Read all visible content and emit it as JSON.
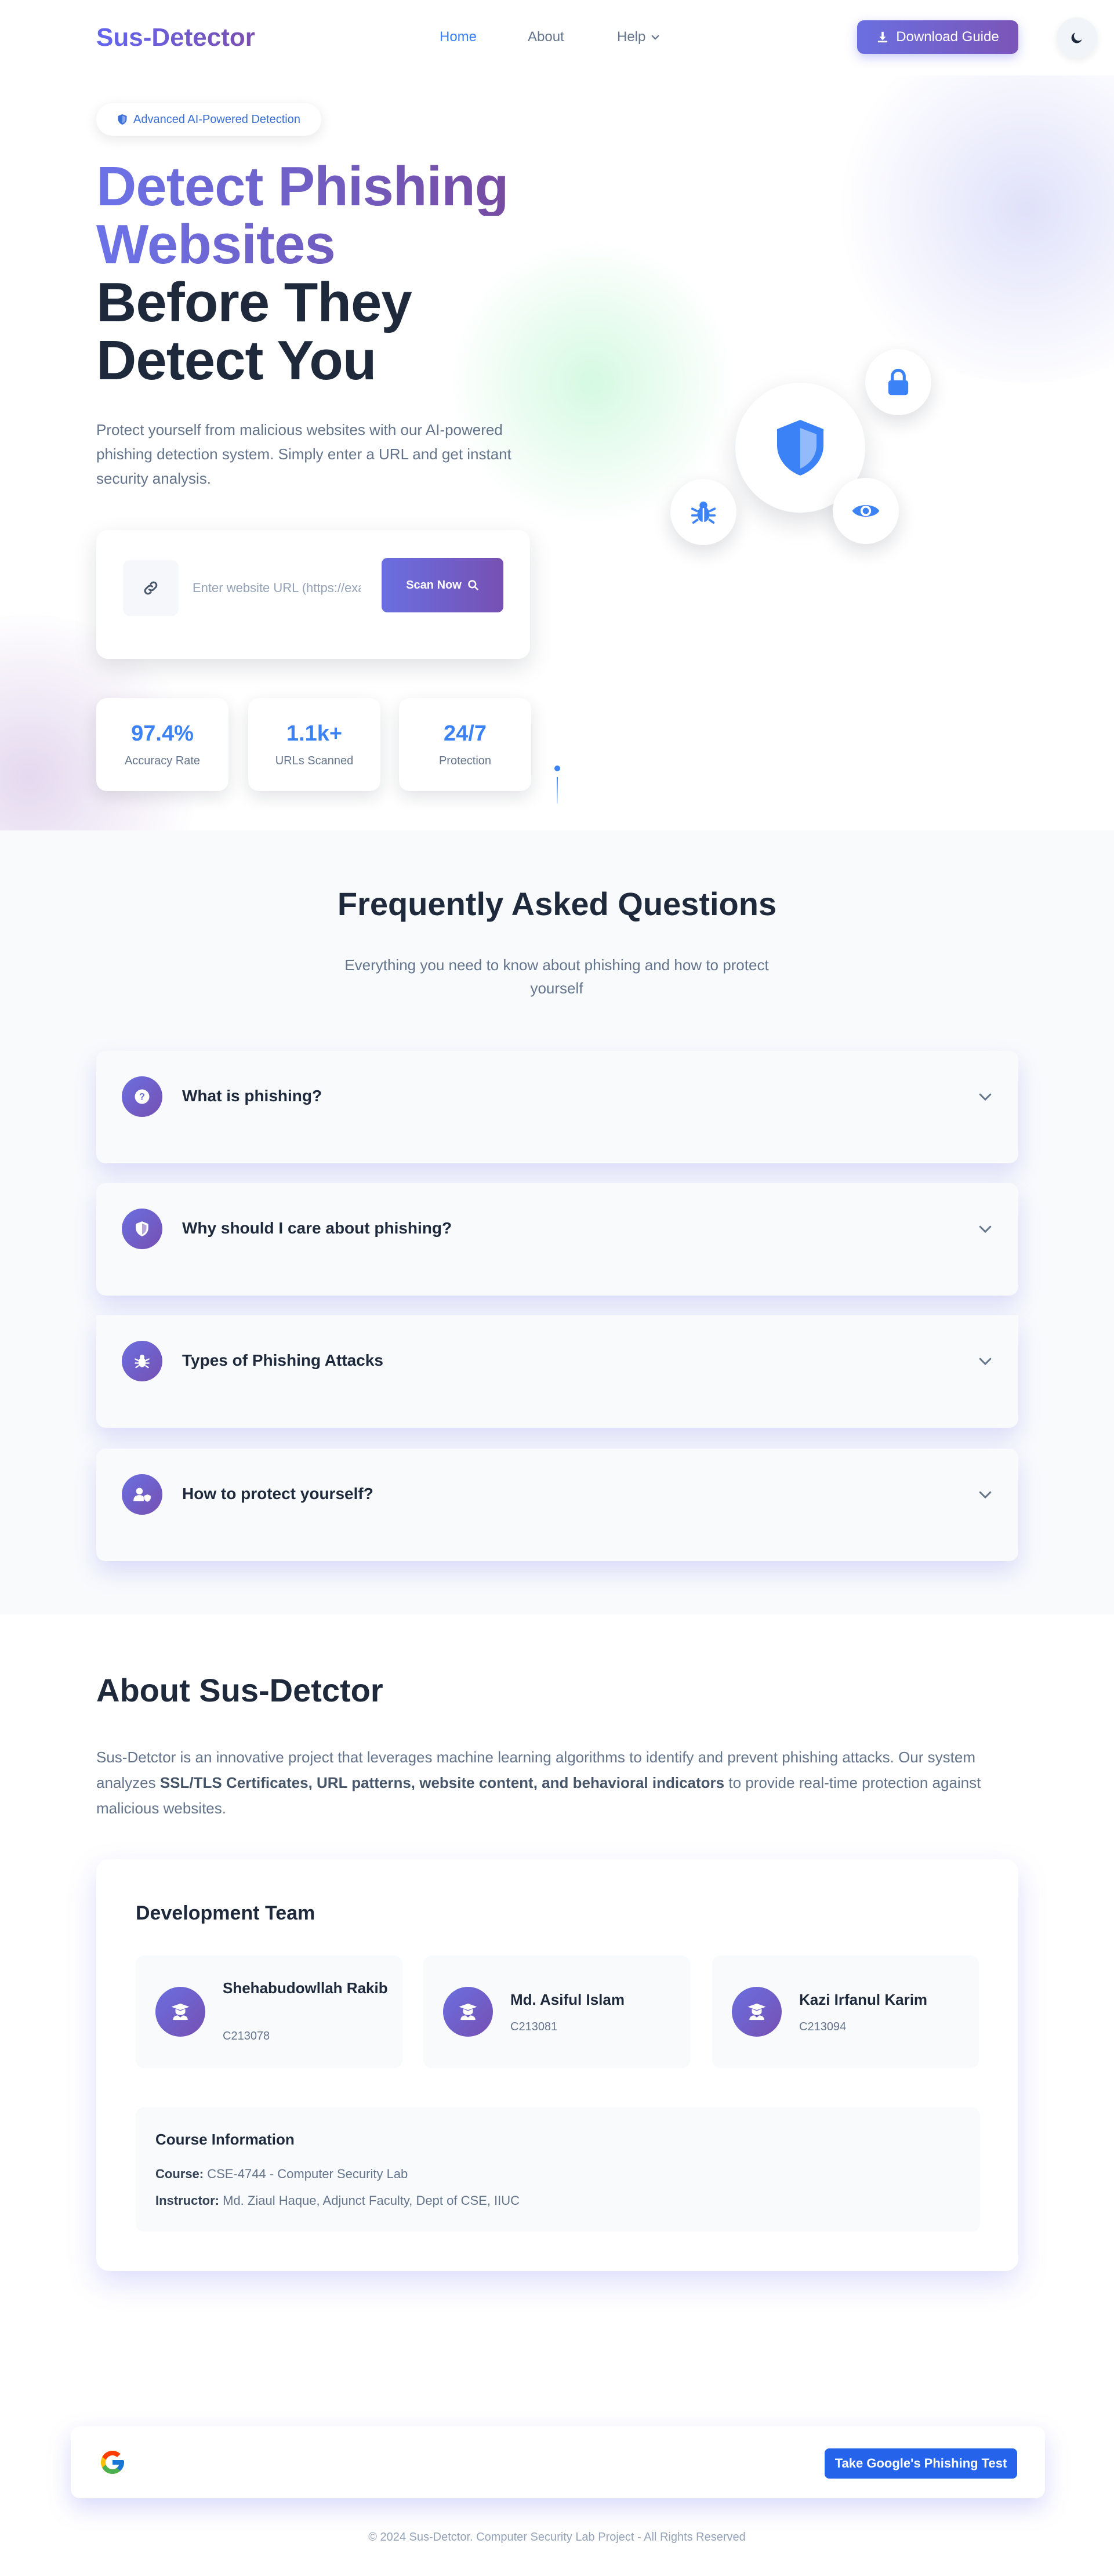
{
  "nav": {
    "logo": "Sus-Detector",
    "links": [
      "Home",
      "About",
      "Help"
    ],
    "download_label": "Download Guide"
  },
  "hero": {
    "badge": "Advanced AI-Powered Detection",
    "title_gradient_1": "Detect Phishing",
    "title_gradient_2": "Websites",
    "title_dark_1": "Before They",
    "title_dark_2": "Detect You",
    "description": "Protect yourself from malicious websites with our AI-powered phishing detection system. Simply enter a URL and get instant security analysis.",
    "input_placeholder": "Enter website URL (https://example.com)",
    "scan_label": "Scan Now",
    "stats": [
      {
        "value": "97.4%",
        "label": "Accuracy Rate"
      },
      {
        "value": "1.1k+",
        "label": "URLs Scanned"
      },
      {
        "value": "24/7",
        "label": "Protection"
      }
    ]
  },
  "faq": {
    "title": "Frequently Asked Questions",
    "subtitle": "Everything you need to know about phishing and how to protect yourself",
    "items": [
      {
        "question": "What is phishing?",
        "icon": "question-circle-icon"
      },
      {
        "question": "Why should I care about phishing?",
        "icon": "shield-icon"
      },
      {
        "question": "Types of Phishing Attacks",
        "icon": "bug-icon"
      },
      {
        "question": "How to protect yourself?",
        "icon": "user-shield-icon"
      }
    ]
  },
  "about": {
    "title": "About Sus-Detctor",
    "desc_pre": "Sus-Detctor is an innovative project that leverages machine learning algorithms to identify and prevent phishing attacks. Our system analyzes ",
    "desc_bold": "SSL/TLS Certificates, URL patterns, website content, and behavioral indicators",
    "desc_post": " to provide real-time protection against malicious websites.",
    "team_title": "Development Team",
    "members": [
      {
        "name": "Shehabudowllah Rakib",
        "id": "C213078"
      },
      {
        "name": "Md. Asiful Islam",
        "id": "C213081"
      },
      {
        "name": "Kazi Irfanul Karim",
        "id": "C213094"
      }
    ],
    "course": {
      "title": "Course Information",
      "course_label": "Course:",
      "course_value": " CSE-4744 - Computer Security Lab",
      "instructor_label": "Instructor:",
      "instructor_value": " Md. Ziaul Haque, Adjunct Faculty, Dept of CSE, IIUC"
    }
  },
  "google_bar": {
    "button_label": "Take Google's Phishing Test"
  },
  "footer": "© 2024 Sus-Detctor. Computer Security Lab Project - All Rights Reserved",
  "colors": {
    "accent_blue": "#3b82f6",
    "gradient_start": "#6a6fe0",
    "gradient_end": "#7650b3",
    "google_button": "#2563eb"
  }
}
